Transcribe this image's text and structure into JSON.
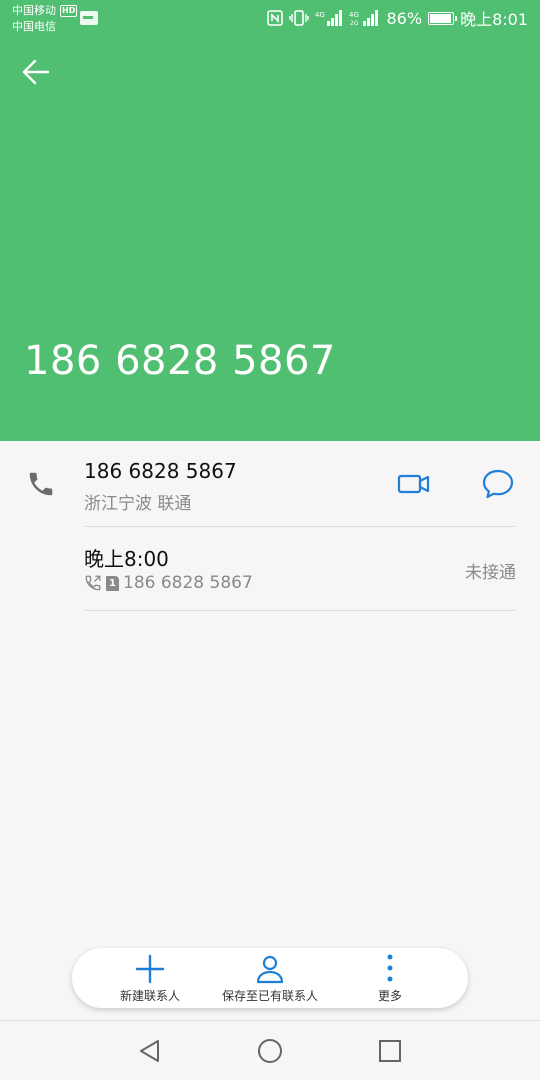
{
  "status_bar": {
    "carrier1": "中国移动",
    "carrier1_badge": "HD",
    "carrier2": "中国电信",
    "battery": "86%",
    "time": "晚上8:01"
  },
  "header": {
    "number": "186 6828 5867",
    "background": "#50bf72"
  },
  "detail": {
    "number": "186 6828 5867",
    "location": "浙江宁波 联通"
  },
  "call_log": {
    "time": "晚上8:00",
    "sim": "1",
    "number": "186 6828 5867",
    "status": "未接通"
  },
  "actions": {
    "new_contact": "新建联系人",
    "save_existing": "保存至已有联系人",
    "more": "更多"
  },
  "colors": {
    "accent": "#1e7fd8",
    "icon_gray": "#6b6b6b"
  },
  "icons": {
    "back": "arrow-left-icon",
    "phone": "phone-icon",
    "video": "video-camera-icon",
    "message": "chat-bubble-icon",
    "add": "plus-icon",
    "person": "person-icon",
    "more": "more-vertical-icon"
  }
}
